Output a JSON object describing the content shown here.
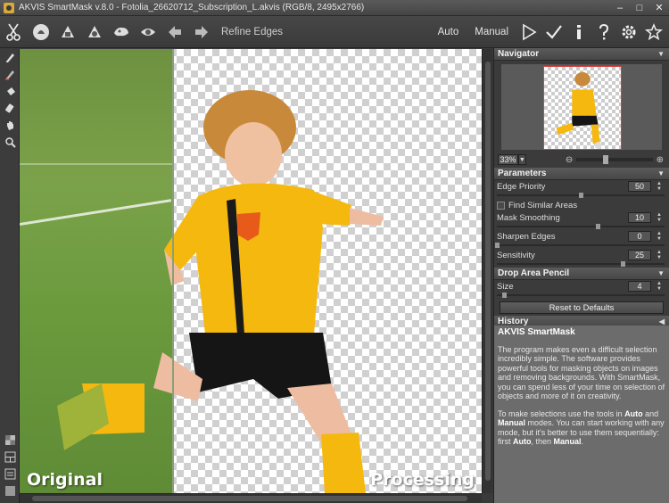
{
  "window": {
    "title": "AKVIS SmartMask v.8.0 - Fotolia_26620712_Subscription_L.akvis (RGB/8, 2495x2766)",
    "controls": [
      "–",
      "□",
      "✕"
    ]
  },
  "toolbar": {
    "left_icons": [
      "scissors-icon",
      "hand-icon",
      "trash-icon",
      "layers-icon",
      "picture-icon",
      "eye-icon"
    ],
    "refine_label": "Refine Edges",
    "mode_auto": "Auto",
    "mode_manual": "Manual",
    "right_icons": [
      "play-icon",
      "check-icon",
      "info-icon",
      "help-icon",
      "settings-icon",
      "star-icon"
    ]
  },
  "canvas": {
    "label_original": "Original",
    "label_processing": "Processing"
  },
  "navigator": {
    "title": "Navigator",
    "zoom": "33%"
  },
  "parameters": {
    "title": "Parameters",
    "edge_priority": {
      "label": "Edge Priority",
      "value": "50",
      "fraction": 0.5
    },
    "find_similar": {
      "label": "Find Similar Areas",
      "checked": false
    },
    "mask_smoothing": {
      "label": "Mask Smoothing",
      "value": "10",
      "fraction": 0.6
    },
    "sharpen_edges": {
      "label": "Sharpen Edges",
      "value": "0",
      "fraction": 0.0
    },
    "sensitivity": {
      "label": "Sensitivity",
      "value": "25",
      "fraction": 0.75
    }
  },
  "drop_area": {
    "title": "Drop Area Pencil",
    "size": {
      "label": "Size",
      "value": "4",
      "fraction": 0.04
    }
  },
  "reset_label": "Reset to Defaults",
  "history": {
    "title": "History"
  },
  "help": {
    "title": "AKVIS SmartMask",
    "p1": "The program makes even a difficult selection incredibly simple. The software provides powerful tools for masking objects on images and removing backgrounds. With SmartMask, you can spend less of your time on selection of objects and more of it on creativity.",
    "p2_a": "To make selections use the tools in ",
    "p2_auto": "Auto",
    "p2_b": " and ",
    "p2_manual": "Manual",
    "p2_c": " modes. You can start working with any mode, but it's better to use them sequentially: first ",
    "p2_auto2": "Auto",
    "p2_d": ", then ",
    "p2_manual2": "Manual",
    "p2_e": "."
  }
}
